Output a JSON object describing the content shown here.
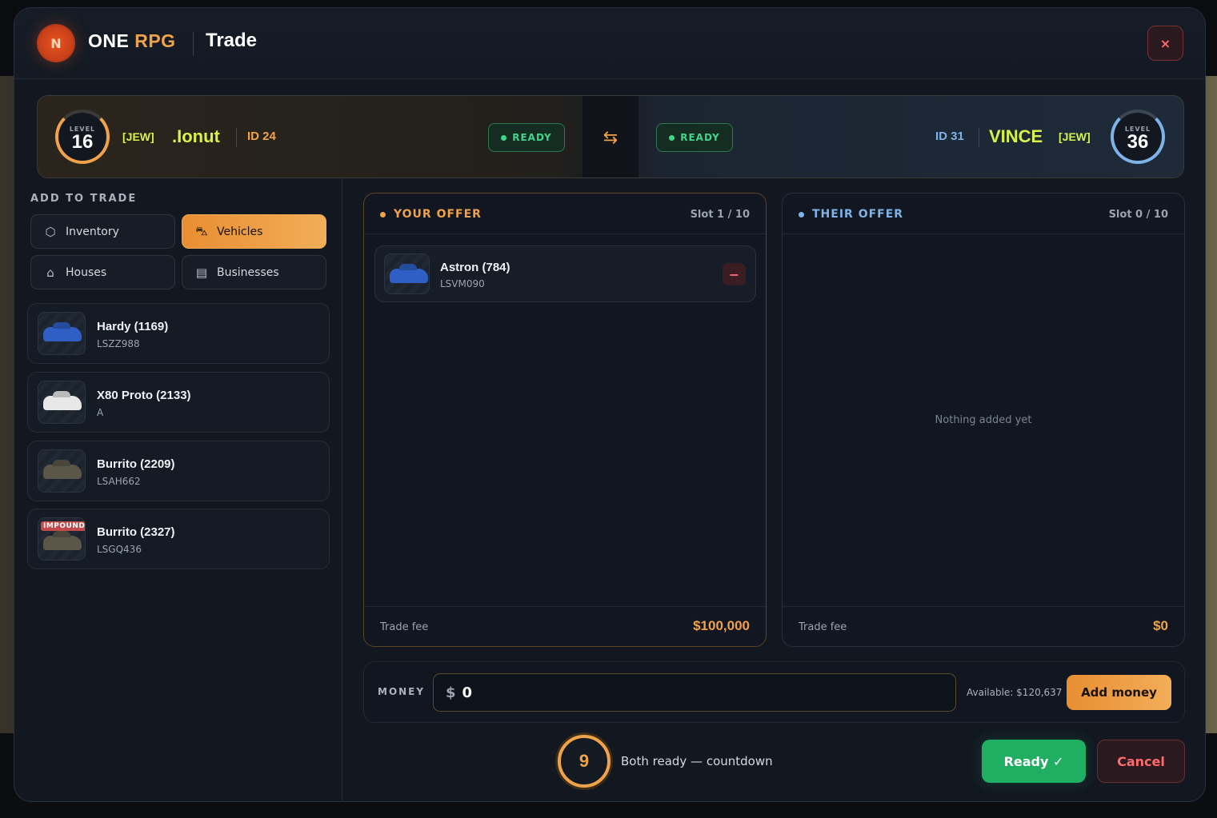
{
  "header": {
    "brand_one": "ONE",
    "brand_rpg": "RPG",
    "title": "Trade",
    "close_label": "×"
  },
  "players": {
    "left": {
      "level_label": "LEVEL",
      "level": "16",
      "tag": "[JEW]",
      "name": ".Ionut",
      "id": "ID 24",
      "status": "READY"
    },
    "right": {
      "level_label": "LEVEL",
      "level": "36",
      "tag": "[JEW]",
      "name": "VINCE",
      "id": "ID 31",
      "status": "READY"
    },
    "swap_icon": "swap-arrows-icon"
  },
  "sidebar": {
    "title": "ADD TO TRADE",
    "categories": [
      {
        "label": "Inventory",
        "icon": "cube-icon"
      },
      {
        "label": "Vehicles",
        "icon": "car-icon"
      },
      {
        "label": "Houses",
        "icon": "house-icon"
      },
      {
        "label": "Businesses",
        "icon": "store-icon"
      }
    ],
    "active_category": "Vehicles",
    "vehicles": [
      {
        "name": "Hardy (1169)",
        "plate": "LSZZ988",
        "color": "#2f5fc4"
      },
      {
        "name": "X80 Proto (2133)",
        "plate": "A",
        "color": "#e8e8e8"
      },
      {
        "name": "Burrito (2209)",
        "plate": "LSAH662",
        "color": "#5a5648"
      },
      {
        "name": "Burrito (2327)",
        "plate": "LSGQ436",
        "color": "#5a5648",
        "badge": "IMPOUND"
      }
    ]
  },
  "your_offer": {
    "title": "YOUR OFFER",
    "slot": "Slot 1 / 10",
    "items": [
      {
        "name": "Astron (784)",
        "plate": "LSVM090",
        "color": "#2f5fc4"
      }
    ],
    "fee_label": "Trade fee",
    "fee": "$100,000",
    "accent": "#f0a24a"
  },
  "their_offer": {
    "title": "THEIR OFFER",
    "slot": "Slot 0 / 10",
    "empty_text": "Nothing added yet",
    "fee_label": "Trade fee",
    "fee": "$0",
    "accent": "#7fb3e8"
  },
  "money": {
    "label": "MONEY",
    "currency": "$",
    "value": "0",
    "available": "Available: $120,637",
    "add_label": "Add money"
  },
  "footer": {
    "countdown": "9",
    "countdown_text": "Both ready — countdown",
    "ready_label": "Ready ✓",
    "cancel_label": "Cancel"
  }
}
